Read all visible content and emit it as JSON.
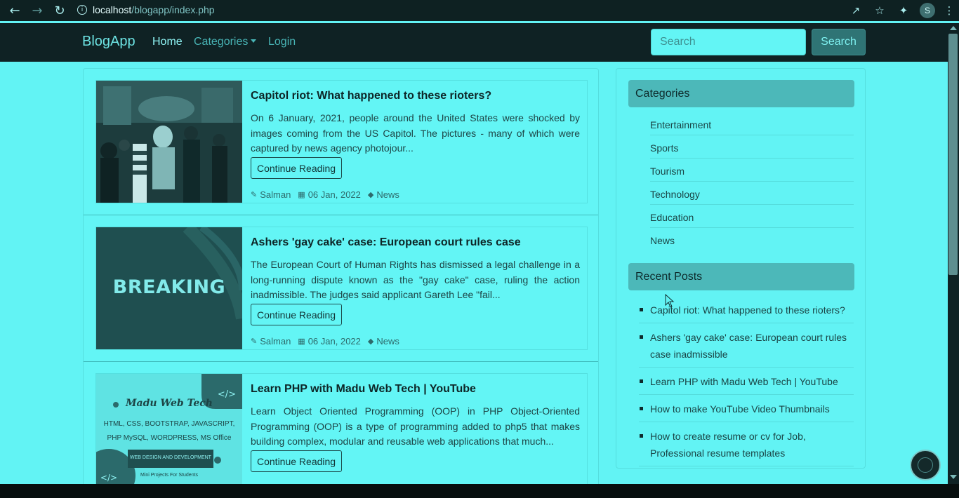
{
  "browser": {
    "url_host": "localhost",
    "url_path": "/blogapp/index.php",
    "profile_initial": "S"
  },
  "navbar": {
    "brand": "BlogApp",
    "home": "Home",
    "categories": "Categories",
    "login": "Login",
    "search_placeholder": "Search",
    "search_button": "Search"
  },
  "posts": [
    {
      "title": "Capitol riot: What happened to these rioters?",
      "excerpt": "On 6 January, 2021, people around the United States were shocked by images coming from the US Capitol. The pictures - many of which were captured by news agency photojour...",
      "button": "Continue Reading",
      "author": "Salman",
      "date": "06 Jan, 2022",
      "category": "News"
    },
    {
      "title": "Ashers 'gay cake' case: European court rules case",
      "excerpt": "The European Court of Human Rights has dismissed a legal challenge in a long-running dispute known as the \"gay cake\" case, ruling the action inadmissible. The judges said applicant Gareth Lee \"fail...",
      "button": "Continue Reading",
      "author": "Salman",
      "date": "06 Jan, 2022",
      "category": "News",
      "image_text": "BREAKING"
    },
    {
      "title": "Learn PHP with Madu Web Tech | YouTube",
      "excerpt": "Learn Object Oriented Programming (OOP) in PHP Object-Oriented Programming (OOP) is a type of programming added to php5 that makes building complex, modular and reusable web applications that much...",
      "button": "Continue Reading",
      "image_title": "Madu Web Tech",
      "image_line1": "HTML, CSS, BOOTSTRAP, JAVASCRIPT,",
      "image_line2": "PHP MySQL, WORDPRESS, MS Office",
      "image_banner": "WEB DESIGN AND DEVELOPMENT",
      "image_footer": "Mini Projects For Students"
    }
  ],
  "sidebar": {
    "categories_title": "Categories",
    "categories": [
      "Entertainment",
      "Sports",
      "Tourism",
      "Technology",
      "Education",
      "News"
    ],
    "recent_title": "Recent Posts",
    "recent": [
      "Capitol riot: What happened to these rioters?",
      "Ashers 'gay cake' case: European court rules case inadmissible",
      "Learn PHP with Madu Web Tech | YouTube",
      "How to make YouTube Video Thumbnails",
      "How to create resume or cv for Job, Professional resume templates"
    ]
  },
  "icons": {
    "back": "arrow-left-icon",
    "forward": "arrow-right-icon",
    "reload": "reload-icon",
    "info": "info-icon",
    "share": "share-icon",
    "star": "star-icon",
    "extensions": "puzzle-icon",
    "menu": "kebab-menu-icon",
    "author": "edit-icon",
    "date": "calendar-icon",
    "tag": "tag-icon"
  },
  "colors": {
    "page_bg": "#62f3f4",
    "navbar_bg": "#0f2224",
    "sidebar_header": "#4cb8b9",
    "search_button": "#2f7475"
  }
}
